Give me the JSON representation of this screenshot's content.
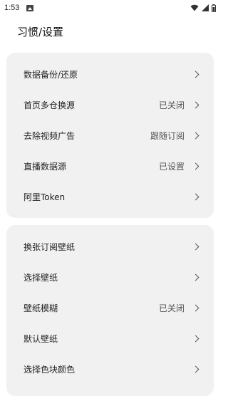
{
  "status_bar": {
    "time": "1:53",
    "icons": [
      "image-icon",
      "wifi-icon",
      "signal-icon",
      "battery-icon"
    ]
  },
  "header": {
    "title": "习惯/设置"
  },
  "groups": [
    {
      "items": [
        {
          "label": "数据备份/还原",
          "value": ""
        },
        {
          "label": "首页多仓换源",
          "value": "已关闭"
        },
        {
          "label": "去除视频广告",
          "value": "跟随订阅"
        },
        {
          "label": "直播数据源",
          "value": "已设置"
        },
        {
          "label": "阿里Token",
          "value": ""
        }
      ]
    },
    {
      "items": [
        {
          "label": "换张订阅壁纸",
          "value": ""
        },
        {
          "label": "选择壁纸",
          "value": ""
        },
        {
          "label": "壁纸模糊",
          "value": "已关闭"
        },
        {
          "label": "默认壁纸",
          "value": ""
        },
        {
          "label": "选择色块颜色",
          "value": ""
        }
      ]
    }
  ],
  "colors": {
    "card_bg": "#f1f1f1",
    "page_bg": "#ffffff",
    "text": "#222222",
    "secondary_text": "#555555"
  }
}
